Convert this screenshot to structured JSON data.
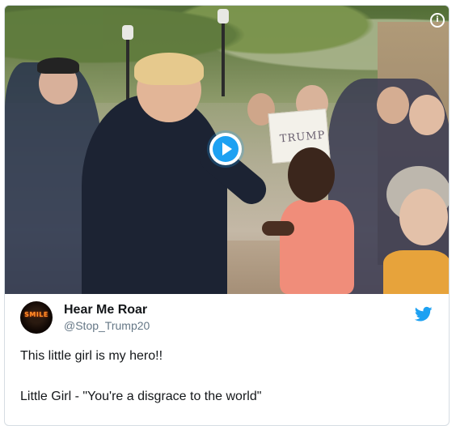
{
  "tweet": {
    "author": {
      "display_name": "Hear Me Roar",
      "handle": "@Stop_Trump20",
      "avatar_text": "SMILE"
    },
    "text_lines": [
      "This little girl is my hero!!",
      "Little Girl - \"You're a disgrace to the world\""
    ]
  },
  "video": {
    "sign_text": "TRUMP",
    "play_icon": "play-icon",
    "info_icon_glyph": "i"
  },
  "icons": {
    "brand": "twitter-bird-icon",
    "info": "info-icon",
    "play": "play-icon"
  },
  "colors": {
    "twitter_blue": "#1da1f2",
    "text_primary": "#14171a",
    "text_secondary": "#657786",
    "card_border": "#d6dde3"
  }
}
